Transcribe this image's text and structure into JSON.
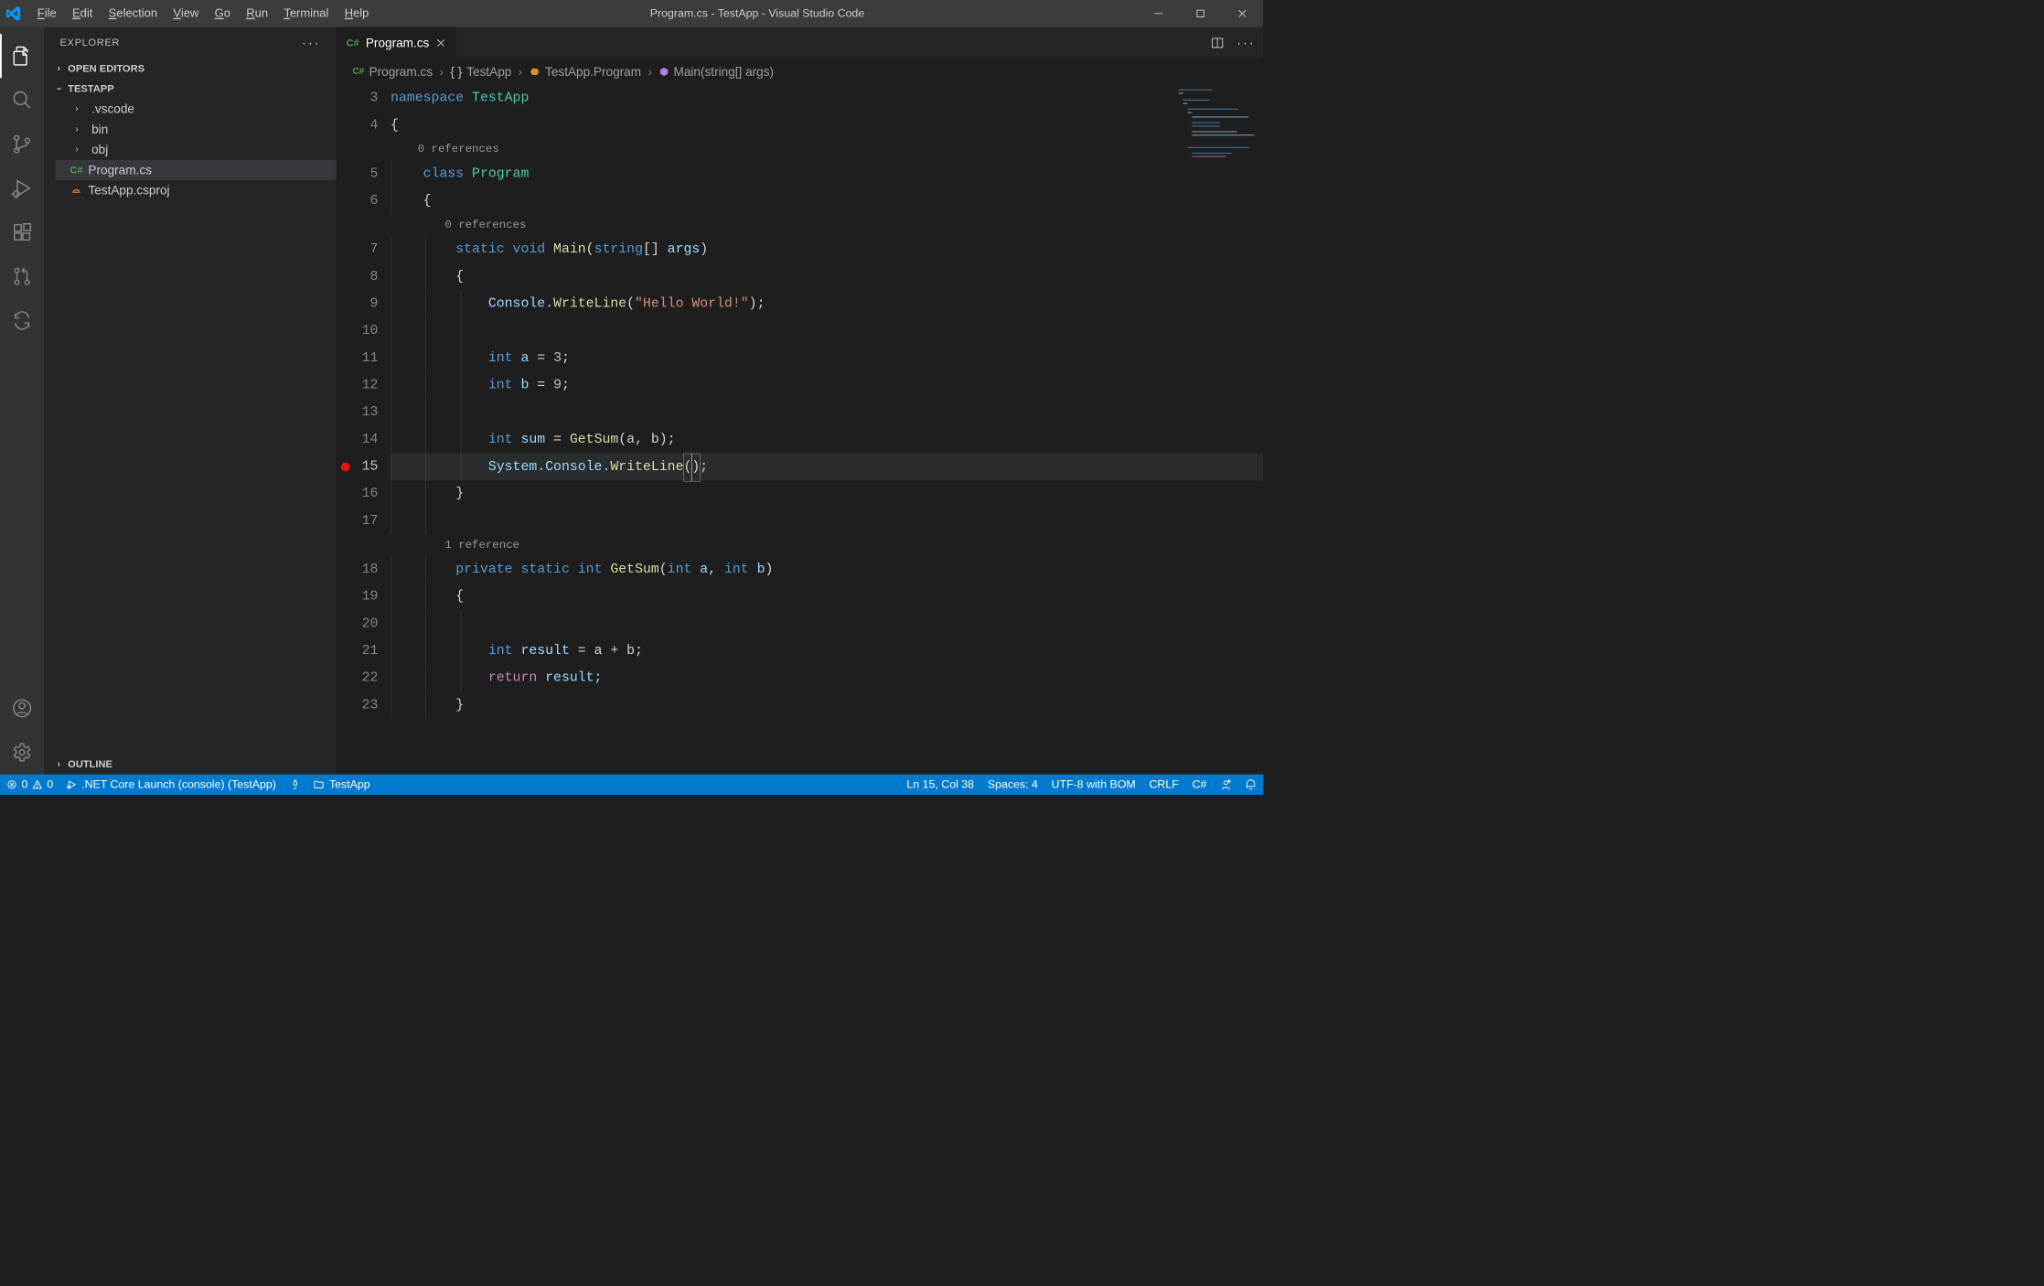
{
  "title": "Program.cs - TestApp - Visual Studio Code",
  "menubar": [
    "File",
    "Edit",
    "Selection",
    "View",
    "Go",
    "Run",
    "Terminal",
    "Help"
  ],
  "sidebar": {
    "title": "EXPLORER",
    "open_editors": "OPEN EDITORS",
    "workspace": "TESTAPP",
    "tree": [
      {
        "label": ".vscode",
        "type": "folder"
      },
      {
        "label": "bin",
        "type": "folder"
      },
      {
        "label": "obj",
        "type": "folder"
      },
      {
        "label": "Program.cs",
        "type": "csharp",
        "selected": true
      },
      {
        "label": "TestApp.csproj",
        "type": "xml"
      }
    ],
    "outline": "OUTLINE"
  },
  "tab": {
    "label": "Program.cs"
  },
  "breadcrumb": {
    "file": "Program.cs",
    "ns": "TestApp",
    "cls": "TestApp.Program",
    "method": "Main(string[] args)"
  },
  "codelens": {
    "zero": "0 references",
    "one": "1 reference"
  },
  "code": {
    "ns_kw": "namespace",
    "ns_name": " TestApp",
    "class_kw": "class",
    "class_name": " Program",
    "main_static": "static",
    "main_void": " void",
    "main_name": " Main",
    "main_params_open": "(",
    "main_string": "string",
    "main_brackets": "[] ",
    "main_args": "args",
    "main_params_close": ")",
    "cw": "Console.",
    "cw_fn": "WriteLine",
    "cw_open": "(",
    "cw_str": "\"Hello World!\"",
    "cw_close": ");",
    "int": "int",
    "a": " a",
    "eq": " = ",
    "three": "3",
    "semi": ";",
    "b": " b",
    "nine": "9",
    "sum": " sum",
    "getsum": "GetSum",
    "args_ab": "(a, b);",
    "sys": "System.Console.",
    "wl": "WriteLine",
    "empty_parens_open": "(",
    "empty_parens_close": ")",
    "priv": "private",
    "stat": " static",
    "int2": " int",
    "gs": " GetSum",
    "sig_open": "(",
    "int_a": "int",
    "pa": " a",
    "comma": ", ",
    "int_b": "int",
    "pb": " b",
    "sig_close": ")",
    "result": " result",
    "aplusb": " = a + b;",
    "return": "return",
    "res2": " result;"
  },
  "statusbar": {
    "errors": "0",
    "warnings": "0",
    "launch": ".NET Core Launch (console) (TestApp)",
    "project": "TestApp",
    "pos": "Ln 15, Col 38",
    "spaces": "Spaces: 4",
    "encoding": "UTF-8 with BOM",
    "eol": "CRLF",
    "lang": "C#"
  }
}
